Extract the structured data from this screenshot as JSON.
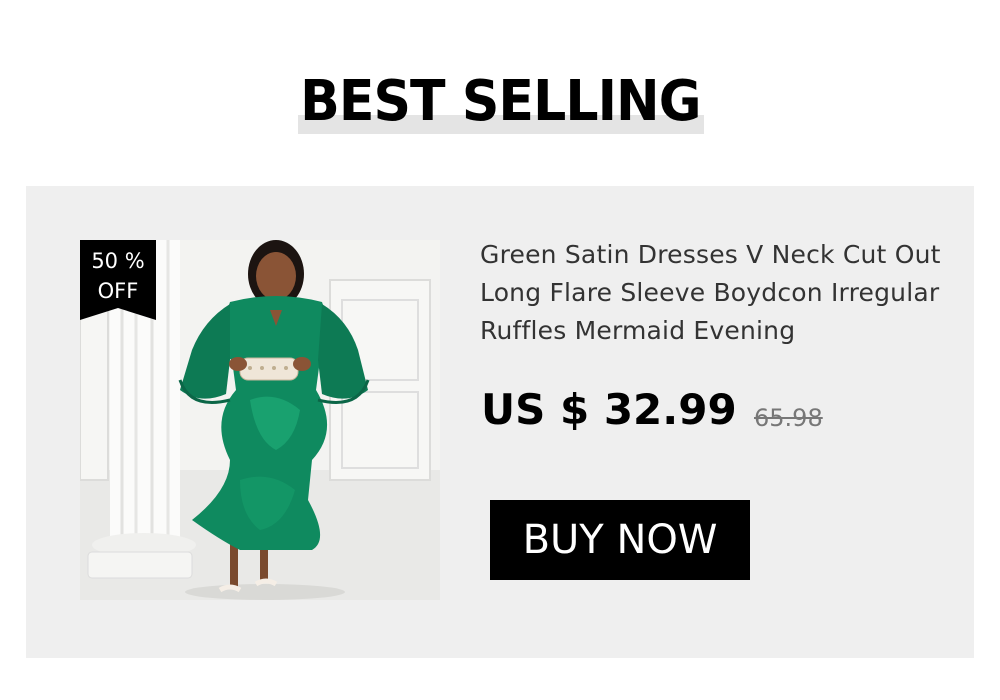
{
  "section": {
    "heading": "BEST SELLING"
  },
  "product": {
    "badge": {
      "line1": "50 %",
      "line2": "OFF"
    },
    "title": "Green Satin Dresses V Neck Cut Out Long Flare Sleeve Boydcon Irregular Ruffles Mermaid Evening",
    "price": "US $ 32.99",
    "old_price": "65.98",
    "buy_label": "BUY NOW",
    "colors": {
      "dress": "#0f8a5f",
      "card_background": "#efefef",
      "button": "#000000"
    }
  }
}
